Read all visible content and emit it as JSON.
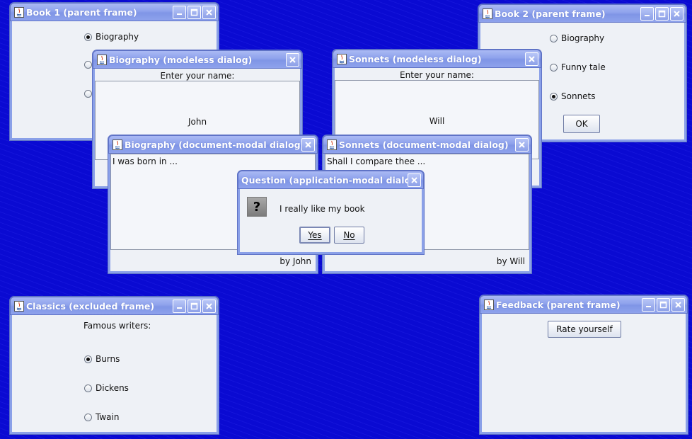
{
  "windows": {
    "book1": {
      "title": "Book 1 (parent frame)",
      "radios": [
        {
          "label": "Biography",
          "checked": true
        },
        {
          "label": "",
          "checked": false
        },
        {
          "label": "",
          "checked": false
        }
      ]
    },
    "book2": {
      "title": "Book 2 (parent frame)",
      "radios": [
        {
          "label": "Biography",
          "checked": false
        },
        {
          "label": "Funny tale",
          "checked": false
        },
        {
          "label": "Sonnets",
          "checked": true
        }
      ],
      "ok_label": "OK"
    },
    "bio_modeless": {
      "title": "Biography (modeless dialog)",
      "prompt": "Enter your name:",
      "name_value": "John"
    },
    "sonnets_modeless": {
      "title": "Sonnets (modeless dialog)",
      "prompt": "Enter your name:",
      "name_value": "Will"
    },
    "bio_docmodal": {
      "title": "Biography  (document-modal dialog)",
      "text": "I was born in ...",
      "author": "by John"
    },
    "sonnets_docmodal": {
      "title": "Sonnets (document-modal dialog)",
      "text": "Shall I compare thee ...",
      "author": "by Will"
    },
    "question": {
      "title": "Question (application-modal dialog)",
      "message": "I really like my book",
      "icon": "question-icon",
      "yes_label": "Yes",
      "no_label": "No"
    },
    "classics": {
      "title": "Classics (excluded frame)",
      "heading": "Famous writers:",
      "radios": [
        {
          "label": "Burns",
          "checked": true
        },
        {
          "label": "Dickens",
          "checked": false
        },
        {
          "label": "Twain",
          "checked": false
        }
      ]
    },
    "feedback": {
      "title": "Feedback (parent frame)",
      "button_label": "Rate yourself"
    }
  },
  "colors": {
    "desktop": "#0a0ad2",
    "titlebar": "#8ea2ec",
    "window_bg": "#eef1f6"
  }
}
